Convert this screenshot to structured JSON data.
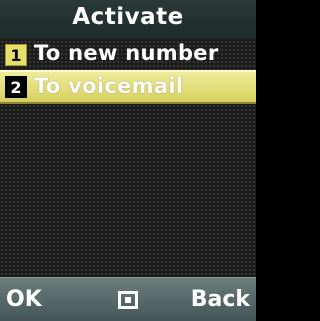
{
  "title": "Activate",
  "menu": {
    "items": [
      {
        "number": "1",
        "label": "To new number"
      },
      {
        "number": "2",
        "label": "To voicemail"
      }
    ],
    "selected_index": 1
  },
  "softkeys": {
    "left": "OK",
    "center_icon": "menu-square-icon",
    "right": "Back"
  },
  "colors": {
    "selection": "#e6df6c",
    "title_bar": "#2a3a39",
    "soft_bar": "#5a6c6b"
  }
}
